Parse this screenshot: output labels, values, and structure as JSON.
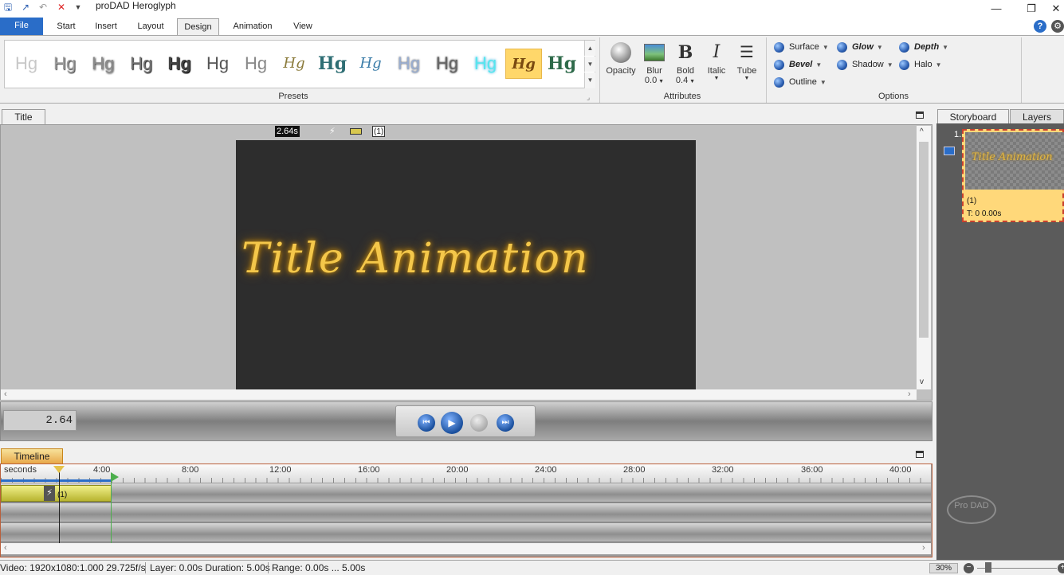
{
  "app": {
    "title": "proDAD Heroglyph"
  },
  "window_controls": {
    "minimize": "—",
    "restore": "❐",
    "close": "✕"
  },
  "menu": {
    "tabs": [
      "File",
      "Start",
      "Insert",
      "Layout",
      "Design",
      "Animation",
      "View"
    ],
    "active": "Design"
  },
  "ribbon": {
    "presets": {
      "label": "Presets",
      "items": [
        "Hg",
        "Hg",
        "Hg",
        "Hg",
        "Hg",
        "Hg",
        "Hg",
        "Hg",
        "Hg",
        "Hg",
        "Hg",
        "Hg",
        "Hg",
        "Hg",
        "Hg"
      ],
      "selected_index": 13
    },
    "attributes": {
      "label": "Attributes",
      "opacity": {
        "label": "Opacity"
      },
      "blur": {
        "label": "Blur",
        "value": "0.0"
      },
      "bold": {
        "label": "Bold",
        "value": "0.4"
      },
      "italic": {
        "label": "Italic"
      },
      "tube": {
        "label": "Tube"
      }
    },
    "options": {
      "label": "Options",
      "surface": "Surface",
      "glow": "Glow",
      "depth": "Depth",
      "bevel": "Bevel",
      "shadow": "Shadow",
      "halo": "Halo",
      "outline": "Outline"
    }
  },
  "title_pane": {
    "tab": "Title",
    "time_badge": "2.64s",
    "layer_badge": "(1)",
    "canvas_text": "Title Animation"
  },
  "transport": {
    "timecode": "2.64"
  },
  "timeline": {
    "tab": "Timeline",
    "unit": "seconds",
    "ticks": [
      "4:00",
      "8:00",
      "12:00",
      "16:00",
      "20:00",
      "24:00",
      "28:00",
      "32:00",
      "36:00",
      "40:00"
    ],
    "clip_label": "(1)"
  },
  "right_panel": {
    "tabs": [
      "Storyboard",
      "Layers"
    ],
    "item_number": "1.",
    "item_name": "(1)",
    "item_time": "T: 0  0.00s",
    "logo": "Pro DAD"
  },
  "status": {
    "video": "Video: 1920x1080:1.000  29.725f/s",
    "layer": "Layer: 0.00s  Duration: 5.00s",
    "range": "Range: 0.00s ... 5.00s",
    "zoom": "30%"
  }
}
